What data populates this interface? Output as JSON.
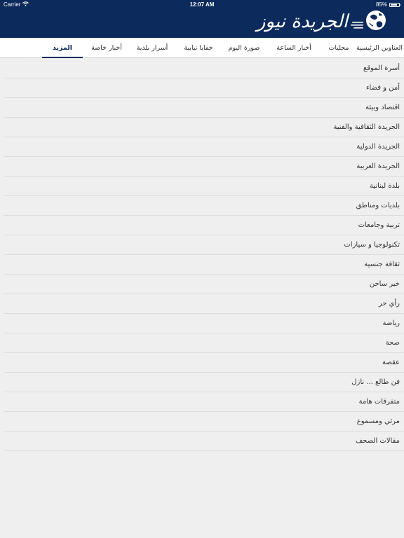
{
  "status_bar": {
    "carrier": "Carrier",
    "time": "12:07 AM",
    "battery": "85%",
    "battery_level": 0.85
  },
  "header": {
    "logo_text": "الجريدة نيوز",
    "background_color": "#0d2a5c"
  },
  "tabs": [
    {
      "label": "العناوين الرئيسية",
      "active": false
    },
    {
      "label": "محليات",
      "active": false
    },
    {
      "label": "أخبار الساعة",
      "active": false
    },
    {
      "label": "صورة اليوم",
      "active": false
    },
    {
      "label": "خفايا نيابية",
      "active": false
    },
    {
      "label": "أسرار بلدية",
      "active": false
    },
    {
      "label": "أخبار خاصة",
      "active": false
    },
    {
      "label": "المزيد",
      "active": true
    }
  ],
  "more_menu": {
    "items": [
      "أسرة الموقع",
      "أمن و قضاء",
      "اقتصاد وبيئة",
      "الجريدة الثقافية والفنية",
      "الجريدة الدولية",
      "الجريدة العربية",
      "بلدة لبنانية",
      "بلديات ومناطق",
      "تربية وجامعات",
      "تكنولوجيا و سيارات",
      "ثقافة جنسية",
      "خبر ساخن",
      "رأي حر",
      "رياضة",
      "صحة",
      "عقصة",
      "فن طالع ... نازل",
      "متفرقات هامة",
      "مرئي ومسموع",
      "مقالات الصحف"
    ]
  }
}
